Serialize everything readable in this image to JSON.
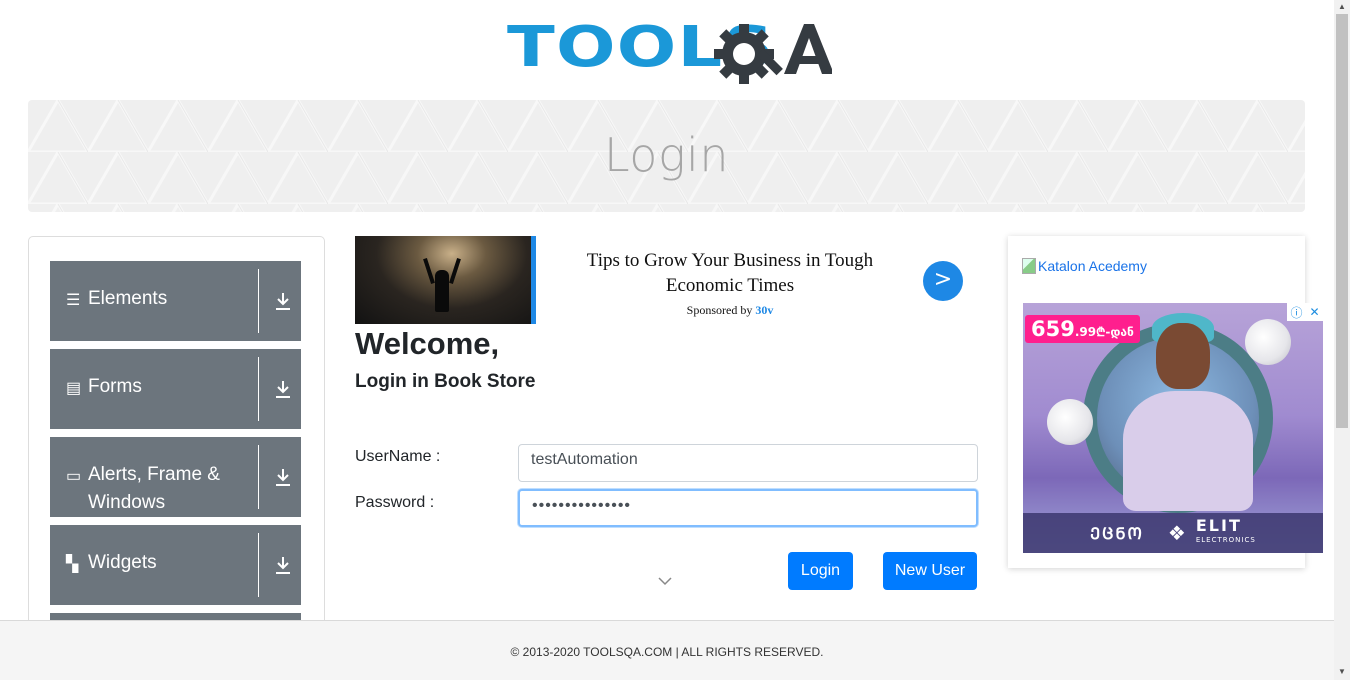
{
  "header": {
    "logo_text": "TOOLSQA"
  },
  "banner": {
    "title": "Login"
  },
  "sidebar": {
    "groups": [
      {
        "label": "Elements",
        "icon": "hamburger-icon"
      },
      {
        "label": "Forms",
        "icon": "document-icon"
      },
      {
        "label": "Alerts, Frame & Windows",
        "icon": "window-icon"
      },
      {
        "label": "Widgets",
        "icon": "widgets-icon"
      }
    ]
  },
  "ad_top": {
    "headline": "Tips to Grow Your Business in Tough Economic Times",
    "sponsored_prefix": "Sponsored by",
    "sponsor": "30v",
    "go_label": ">"
  },
  "login": {
    "welcome": "Welcome,",
    "subtitle": "Login in Book Store",
    "username_label": "UserName :",
    "username_value": "testAutomation",
    "password_label": "Password :",
    "password_value": "•••••••••••••••",
    "login_button": "Login",
    "new_user_button": "New User"
  },
  "ad_right": {
    "katalon_alt": "Katalon Acedemy",
    "price_main": "659",
    "price_cents": ".99₾-დან",
    "brand_left": "ᲔᲪᲜᲝ",
    "brand_right": "ELIT",
    "brand_sub": "ELECTRONICS"
  },
  "footer": {
    "copyright": "© 2013-2020 TOOLSQA.COM | ALL RIGHTS RESERVED."
  },
  "colors": {
    "primary": "#007bff",
    "sidebar_bg": "#6c757d",
    "logo_blue": "#1b98d8",
    "logo_dark": "#353b41"
  }
}
